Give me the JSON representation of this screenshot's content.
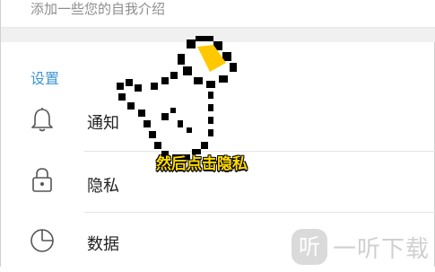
{
  "profile": {
    "bio_placeholder": "添加一些您的自我介绍"
  },
  "settings": {
    "section_title": "设置",
    "items": [
      {
        "label": "通知",
        "icon": "bell-icon"
      },
      {
        "label": "隐私",
        "icon": "lock-icon"
      },
      {
        "label": "数据",
        "icon": "pie-chart-icon"
      }
    ]
  },
  "overlay": {
    "caption": "然后点击隐私",
    "cursor_icon": "pointing-hand-cursor-icon"
  },
  "watermark": {
    "badge_text": "听",
    "text": "一听下载"
  },
  "colors": {
    "accent": "#3f96d6",
    "caption": "#ffdb00",
    "cursor_cuff": "#ffc800"
  }
}
